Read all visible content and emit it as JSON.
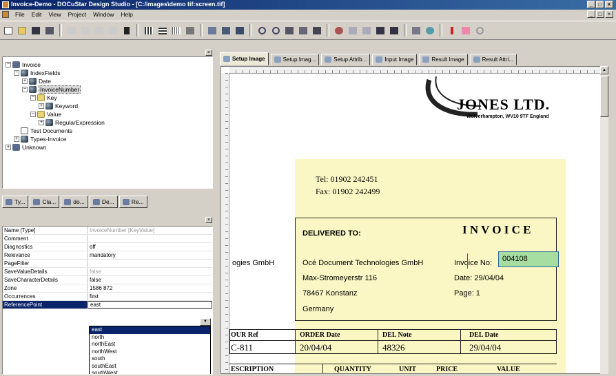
{
  "window": {
    "title": "Invoice-Demo - DOCuStar Design Studio - [C:/images\\demo tif:screen.tif]"
  },
  "menu": [
    "File",
    "Edit",
    "View",
    "Project",
    "Window",
    "Help"
  ],
  "tree": {
    "nodes": [
      {
        "label": "Invoice"
      },
      {
        "label": "IndexFields"
      },
      {
        "label": "Date"
      },
      {
        "label": "InvoiceNumber"
      },
      {
        "label": "Key"
      },
      {
        "label": "Keyword"
      },
      {
        "label": "Value"
      },
      {
        "label": "RegularExpression"
      },
      {
        "label": "Test Documents"
      },
      {
        "label": "Types-Invoice"
      },
      {
        "label": "Unknown"
      }
    ]
  },
  "left_tabs": [
    "Ty...",
    "Cla...",
    "do...",
    "De...",
    "Re..."
  ],
  "properties": [
    {
      "key": "Name [Type]",
      "value": "InvoiceNumber [KeyValue]"
    },
    {
      "key": "Comment",
      "value": ""
    },
    {
      "key": "Diagnostics",
      "value": "off"
    },
    {
      "key": "Relevance",
      "value": "mandatory"
    },
    {
      "key": "PageFilter",
      "value": ""
    },
    {
      "key": "SaveValueDetails",
      "value": "false"
    },
    {
      "key": "SaveCharacterDetails",
      "value": "false"
    },
    {
      "key": "Zone",
      "value": "1586 872"
    },
    {
      "key": "Occurrences",
      "value": "first"
    },
    {
      "key": "ReferencePoint",
      "value": "east"
    }
  ],
  "dropdown_options": [
    "east",
    "north",
    "northEast",
    "northWest",
    "south",
    "southEast",
    "southWest"
  ],
  "right_tabs": [
    "Setup Image",
    "Setup Imag...",
    "Setup Attrib...",
    "Input Image",
    "Result Image",
    "Result Attri..."
  ],
  "document": {
    "logo_name": "JONES LTD.",
    "logo_address": "Wolverhampton, WV10 9TF England",
    "tel": "Tel:   01902 242451",
    "fax": "Fax:   01902 242499",
    "delivered_to": "DELIVERED TO:",
    "invoice_heading": "I N V O I C E",
    "left_company": "ogies GmbH",
    "address": [
      "Océ Document Technologies GmbH",
      "Max-Stromeyerstr 116",
      "78467 Konstanz",
      "Germany"
    ],
    "invoice_no_label": "Invoice No:",
    "invoice_no_value": "004108",
    "date_label": "Date:  29/04/04",
    "page_label": "Page:  1",
    "table": {
      "headers": [
        "OUR Ref",
        "ORDER Date",
        "DEL Note",
        "DEL Date"
      ],
      "values": [
        "C-811",
        "20/04/04",
        "48326",
        "29/04/04"
      ]
    },
    "items_headers": [
      "ESCRIPTION",
      "QUANTITY",
      "UNIT",
      "PRICE",
      "VALUE"
    ]
  },
  "colors": {
    "title_bar": "#0a246a",
    "document_highlight": "#fbf7c4",
    "field_match": "#a6dea2",
    "selection": "#0a246a"
  }
}
